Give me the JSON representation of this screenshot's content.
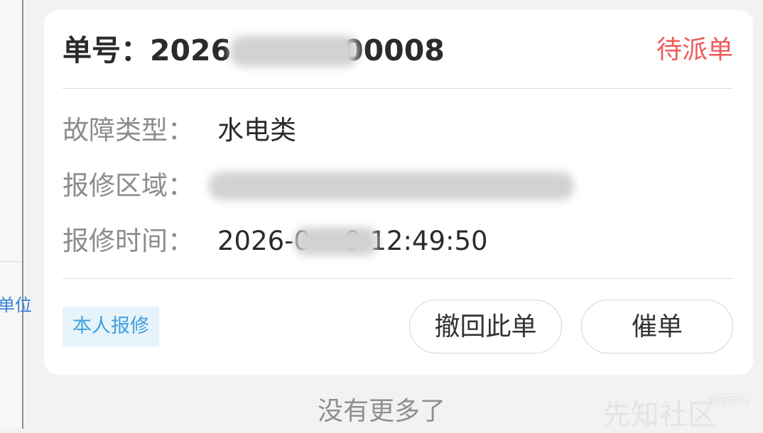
{
  "left_panel": {
    "label": "单位"
  },
  "order": {
    "label": "单号：",
    "number_prefix": "2026",
    "number_suffix": "00008",
    "status": "待派单"
  },
  "details": [
    {
      "key": "故障类型：",
      "value": "水电类"
    },
    {
      "key": "报修区域：",
      "value": ""
    },
    {
      "key": "报修时间：",
      "value": "2026-0",
      "value_tail": "9 12:49:50"
    }
  ],
  "tag": "本人报修",
  "buttons": {
    "withdraw": "撤回此单",
    "urge": "催单"
  },
  "footer": "没有更多了",
  "watermarks": {
    "brand": "先知社区",
    "site": "渗透云记"
  }
}
